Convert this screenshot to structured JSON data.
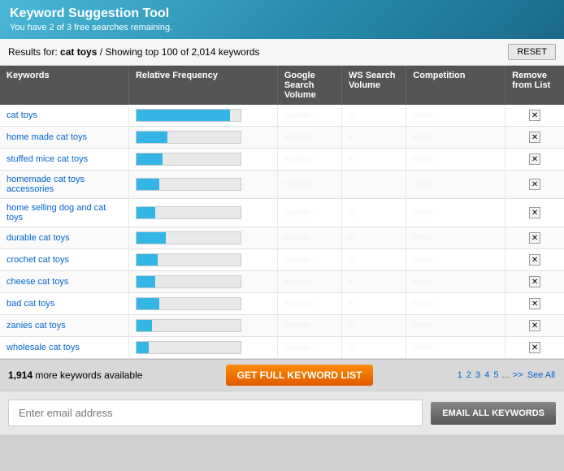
{
  "header": {
    "title": "Keyword Suggestion Tool",
    "subtitle": "You have 2 of 3 free searches remaining."
  },
  "results": {
    "label": "Results for:",
    "keyword": "cat toys",
    "showing": "/ Showing top 100 of 2,014 keywords",
    "reset_label": "RESET"
  },
  "columns": {
    "keywords": "Keywords",
    "relative_frequency": "Relative Frequency",
    "google_search_volume": "Google Search Volume",
    "ws_search_volume": "WS Search Volume",
    "competition": "Competition",
    "remove_from_list": "Remove from List"
  },
  "rows": [
    {
      "keyword": "cat toys",
      "freq_pct": 90,
      "gsv": "~~,~~~",
      "ws": "~",
      "comp": "~~~~",
      "checked": true
    },
    {
      "keyword": "home made cat toys",
      "freq_pct": 30,
      "gsv": "~~,~~~",
      "ws": "~",
      "comp": "~~~~",
      "checked": true
    },
    {
      "keyword": "stuffed mice cat toys",
      "freq_pct": 25,
      "gsv": "~~,~~~",
      "ws": "~",
      "comp": "~~~~",
      "checked": true
    },
    {
      "keyword": "homemade cat toys accessories",
      "freq_pct": 22,
      "gsv": "~~,~~~",
      "ws": "~",
      "comp": "~~~~",
      "checked": true
    },
    {
      "keyword": "home selling dog and cat toys",
      "freq_pct": 18,
      "gsv": "~~,~~~",
      "ws": "~",
      "comp": "~~~~",
      "checked": true
    },
    {
      "keyword": "durable cat toys",
      "freq_pct": 28,
      "gsv": "~~,~~~",
      "ws": "~",
      "comp": "~~~~",
      "checked": true
    },
    {
      "keyword": "crochet cat toys",
      "freq_pct": 20,
      "gsv": "~~,~~~",
      "ws": "~",
      "comp": "~~~~",
      "checked": true
    },
    {
      "keyword": "cheese cat toys",
      "freq_pct": 18,
      "gsv": "~~,~~~",
      "ws": "~",
      "comp": "~~~~",
      "checked": true
    },
    {
      "keyword": "bad cat toys",
      "freq_pct": 22,
      "gsv": "~~,~~~",
      "ws": "~",
      "comp": "~~~~",
      "checked": true
    },
    {
      "keyword": "zanies cat toys",
      "freq_pct": 15,
      "gsv": "~~,~~~",
      "ws": "~",
      "comp": "~~~~",
      "checked": true
    },
    {
      "keyword": "wholesale cat toys",
      "freq_pct": 12,
      "gsv": "~~,~~~",
      "ws": "~",
      "comp": "~~~~",
      "checked": true
    }
  ],
  "bottom": {
    "more_count": "1,914",
    "more_label": "more keywords available",
    "get_full_label": "GET FULL KEYWORD LIST",
    "pagination": [
      "1",
      "2",
      "3",
      "4",
      "5",
      "...",
      ">>",
      "See All"
    ]
  },
  "email": {
    "placeholder": "Enter email address",
    "button_label": "EMAIL ALL KEYWORDS"
  }
}
